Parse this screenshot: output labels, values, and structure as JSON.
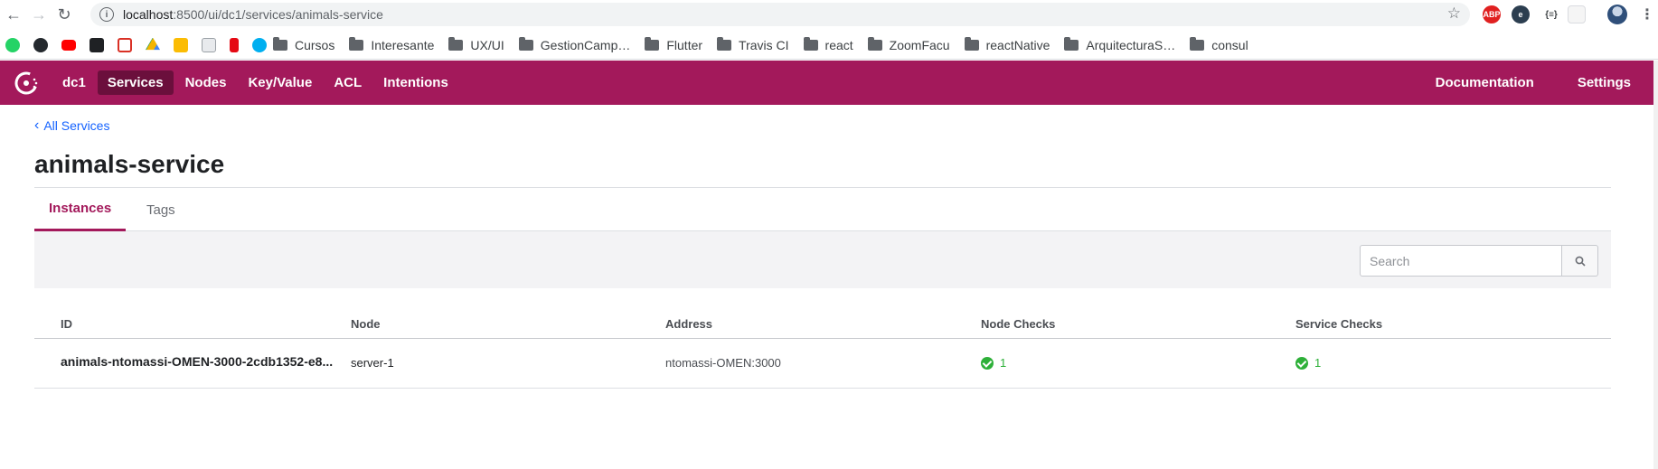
{
  "browser": {
    "url_host": "localhost",
    "url_path": ":8500/ui/dc1/services/animals-service",
    "bookmarks": [
      {
        "label": "Cursos",
        "type": "folder"
      },
      {
        "label": "Interesante",
        "type": "folder"
      },
      {
        "label": "UX/UI",
        "type": "folder"
      },
      {
        "label": "GestionCamp…",
        "type": "folder"
      },
      {
        "label": "Flutter",
        "type": "folder"
      },
      {
        "label": "Travis CI",
        "type": "folder"
      },
      {
        "label": "react",
        "type": "folder"
      },
      {
        "label": "ZoomFacu",
        "type": "folder"
      },
      {
        "label": "reactNative",
        "type": "folder"
      },
      {
        "label": "ArquitecturaS…",
        "type": "folder"
      },
      {
        "label": "consul",
        "type": "folder"
      }
    ],
    "extensions": [
      "ABP",
      "e",
      "{≡}"
    ]
  },
  "header": {
    "datacenter": "dc1",
    "nav": [
      "Services",
      "Nodes",
      "Key/Value",
      "ACL",
      "Intentions"
    ],
    "active_nav": "Services",
    "right_nav": [
      "Documentation",
      "Settings"
    ],
    "brand_color": "#a3195b"
  },
  "page": {
    "back_label": "All Services",
    "title": "animals-service",
    "tabs": [
      "Instances",
      "Tags"
    ],
    "active_tab": "Instances",
    "search_placeholder": "Search"
  },
  "table": {
    "columns": [
      "ID",
      "Node",
      "Address",
      "Node Checks",
      "Service Checks"
    ],
    "rows": [
      {
        "id": "animals-ntomassi-OMEN-3000-2cdb1352-e8...",
        "node": "server-1",
        "address": "ntomassi-OMEN:3000",
        "node_checks": "1",
        "service_checks": "1"
      }
    ]
  }
}
